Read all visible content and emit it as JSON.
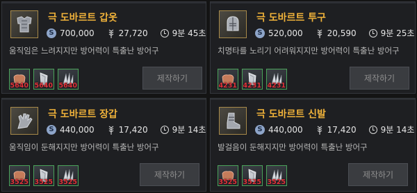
{
  "colors": {
    "title": "#f0b23a",
    "material_count": "#e0333a",
    "material_border": "#4aa35a"
  },
  "cards": [
    {
      "name": "극 도바르트 갑옷",
      "price": "700,000",
      "contribution": "27,720",
      "time": "9분 45초",
      "description": "움직임은 느려지지만 방어력이 특출난 방어구",
      "button": "제작하기",
      "materials": [
        {
          "icon": "leather-material",
          "count": "5640"
        },
        {
          "icon": "steel-material",
          "count": "5640"
        },
        {
          "icon": "crystal-material",
          "count": "5640"
        }
      ]
    },
    {
      "name": "극 도바르트 투구",
      "price": "520,000",
      "contribution": "20,590",
      "time": "9분 25초",
      "description": "치명타를 노리기 어려워지지만 방어력이 특출난 방어구",
      "button": "제작하기",
      "materials": [
        {
          "icon": "leather-material",
          "count": "4231"
        },
        {
          "icon": "steel-material",
          "count": "4231"
        },
        {
          "icon": "crystal-material",
          "count": "4231"
        }
      ]
    },
    {
      "name": "극 도바르트 장갑",
      "price": "440,000",
      "contribution": "17,420",
      "time": "9분 14초",
      "description": "움직임이 둔해지지만 방어력이 특출난 방어구",
      "button": "제작하기",
      "materials": [
        {
          "icon": "leather-material",
          "count": "3525"
        },
        {
          "icon": "steel-material",
          "count": "3525"
        },
        {
          "icon": "crystal-material",
          "count": "3525"
        }
      ]
    },
    {
      "name": "극 도바르트 신발",
      "price": "440,000",
      "contribution": "17,420",
      "time": "9분 14초",
      "description": "발걸음이 둔해지지만 방어력이 특출난 방어구",
      "button": "제작하기",
      "materials": [
        {
          "icon": "leather-material",
          "count": "3525"
        },
        {
          "icon": "steel-material",
          "count": "3525"
        },
        {
          "icon": "crystal-material",
          "count": "3525"
        }
      ]
    }
  ]
}
